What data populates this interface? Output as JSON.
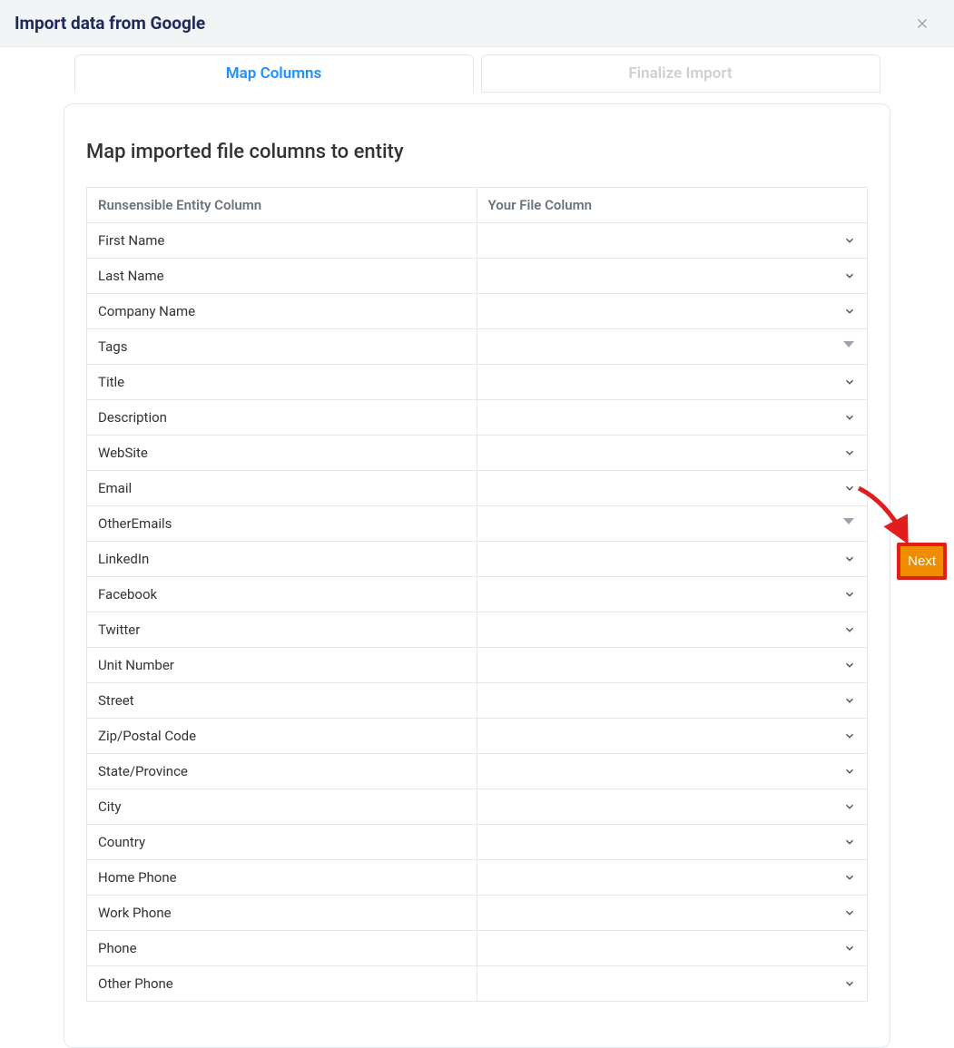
{
  "header": {
    "title": "Import data from Google"
  },
  "tabs": {
    "map_columns": "Map Columns",
    "finalize_import": "Finalize Import"
  },
  "panel": {
    "title": "Map imported file columns to entity",
    "col_entity": "Runsensible Entity Column",
    "col_file": "Your File Column"
  },
  "rows": [
    {
      "label": "First Name",
      "style": "chevron"
    },
    {
      "label": "Last Name",
      "style": "chevron"
    },
    {
      "label": "Company Name",
      "style": "chevron"
    },
    {
      "label": "Tags",
      "style": "triangle"
    },
    {
      "label": "Title",
      "style": "chevron"
    },
    {
      "label": "Description",
      "style": "chevron"
    },
    {
      "label": "WebSite",
      "style": "chevron"
    },
    {
      "label": "Email",
      "style": "chevron"
    },
    {
      "label": "OtherEmails",
      "style": "triangle"
    },
    {
      "label": "LinkedIn",
      "style": "chevron"
    },
    {
      "label": "Facebook",
      "style": "chevron"
    },
    {
      "label": "Twitter",
      "style": "chevron"
    },
    {
      "label": "Unit Number",
      "style": "chevron"
    },
    {
      "label": "Street",
      "style": "chevron"
    },
    {
      "label": "Zip/Postal Code",
      "style": "chevron"
    },
    {
      "label": "State/Province",
      "style": "chevron"
    },
    {
      "label": "City",
      "style": "chevron"
    },
    {
      "label": "Country",
      "style": "chevron"
    },
    {
      "label": "Home Phone",
      "style": "chevron"
    },
    {
      "label": "Work Phone",
      "style": "chevron"
    },
    {
      "label": "Phone",
      "style": "chevron"
    },
    {
      "label": "Other Phone",
      "style": "chevron"
    }
  ],
  "next_button": "Next"
}
